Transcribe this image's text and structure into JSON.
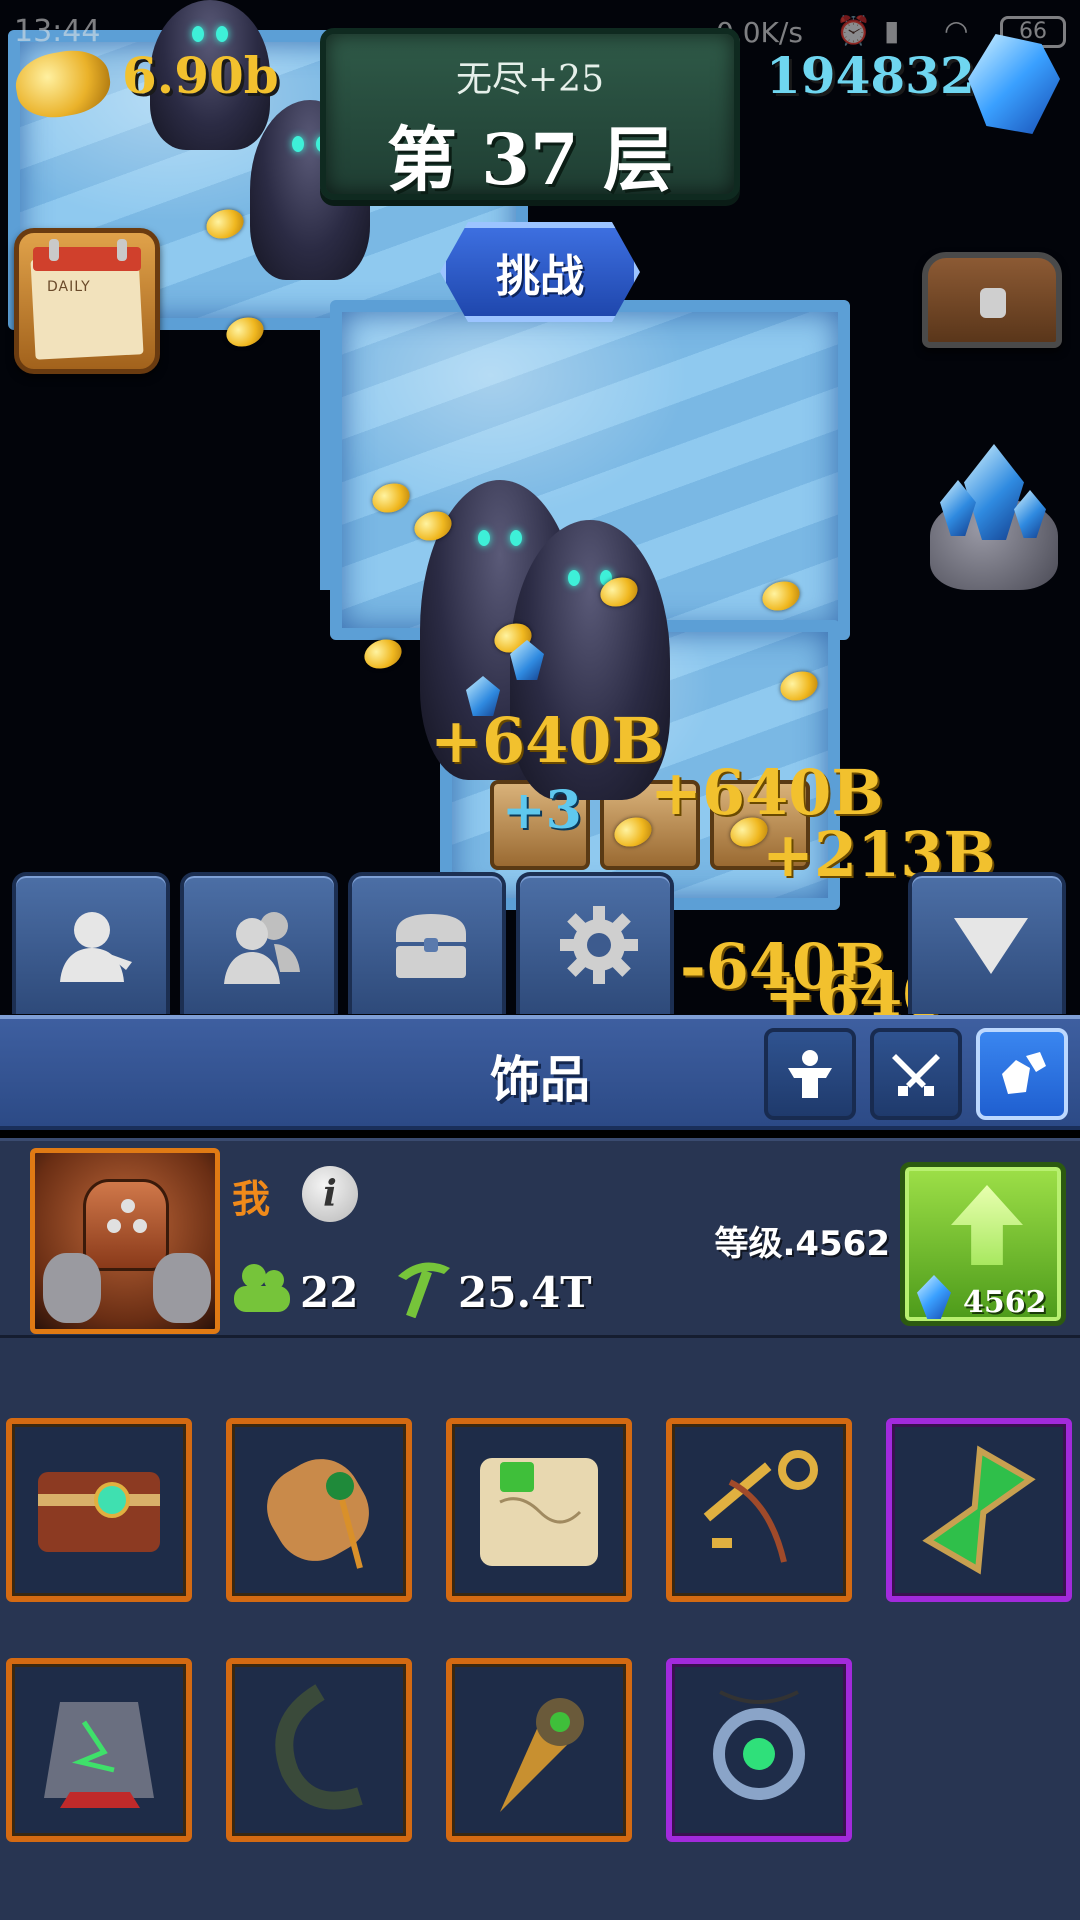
{
  "status_bar": {
    "time": "13:44",
    "net_speed": "0.0K/s",
    "battery": "66"
  },
  "hud": {
    "gold": "6.90b",
    "gems": "194832",
    "mode_label": "无尽+25",
    "floor_label": "第 37 层",
    "challenge_label": "挑战"
  },
  "calendar": {
    "label": "DAILY"
  },
  "floating_numbers": [
    "+640B",
    "+3",
    "+640B",
    "+213B",
    "-640B",
    "+640"
  ],
  "tabs": [
    "profile",
    "party",
    "chest",
    "settings",
    "collapse"
  ],
  "panel": {
    "title": "饰品",
    "filters": [
      {
        "icon": "strength-icon",
        "active": false
      },
      {
        "icon": "crossed-swords-icon",
        "active": false
      },
      {
        "icon": "gems-icon",
        "active": true
      }
    ]
  },
  "profile": {
    "name": "我",
    "info_icon": "i",
    "members": "22",
    "mining_power": "25.4T",
    "level_text": "等级.4562",
    "upgrade_cost": "4562"
  },
  "inventory": {
    "items": [
      {
        "icon": "spellbook-icon",
        "rarity": "legendary"
      },
      {
        "icon": "scroll-icon",
        "rarity": "legendary"
      },
      {
        "icon": "treasure-map-icon",
        "rarity": "legendary"
      },
      {
        "icon": "key-icon",
        "rarity": "legendary"
      },
      {
        "icon": "hourglass-icon",
        "rarity": "epic"
      },
      {
        "icon": "rune-stone-icon",
        "rarity": "legendary"
      },
      {
        "icon": "horn-icon",
        "rarity": "legendary"
      },
      {
        "icon": "drill-icon",
        "rarity": "legendary"
      },
      {
        "icon": "amulet-icon",
        "rarity": "epic"
      }
    ]
  },
  "colors": {
    "gold_text": "#f2c12e",
    "gem_text": "#6fd6f0",
    "legendary_border": "#d46a12",
    "epic_border": "#a22adc",
    "upgrade_green": "#7cc430"
  }
}
